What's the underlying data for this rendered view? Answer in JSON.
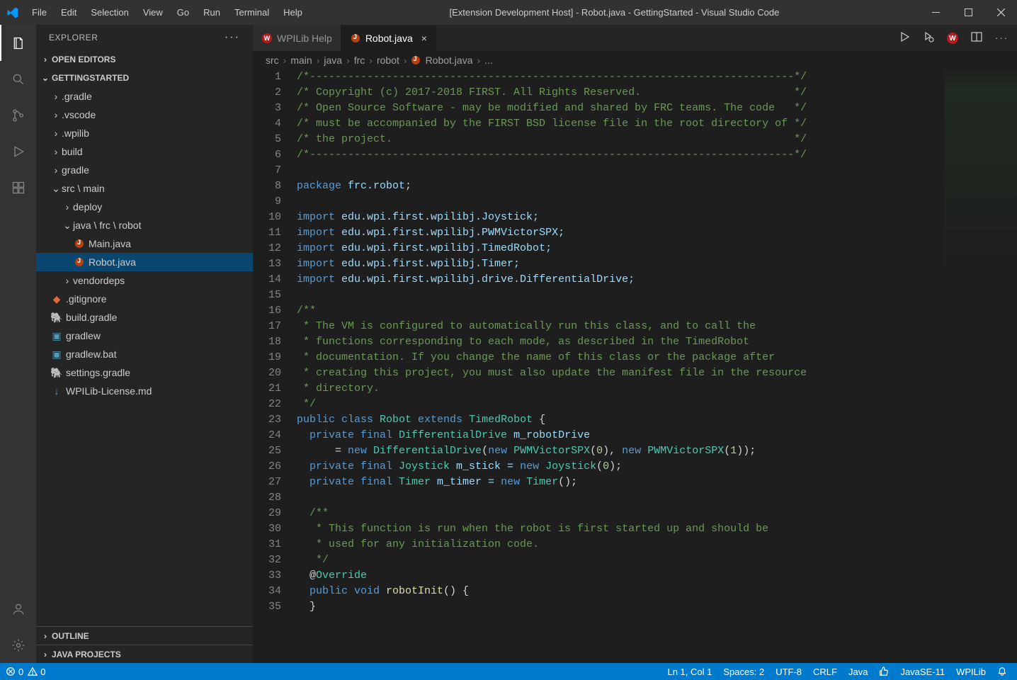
{
  "titlebar": {
    "title": "[Extension Development Host] - Robot.java - GettingStarted - Visual Studio Code"
  },
  "menubar": [
    "File",
    "Edit",
    "Selection",
    "View",
    "Go",
    "Run",
    "Terminal",
    "Help"
  ],
  "sidebar": {
    "title": "EXPLORER",
    "openEditors": "OPEN EDITORS",
    "workspace": "GETTINGSTARTED",
    "outline": "OUTLINE",
    "javaProjects": "JAVA PROJECTS",
    "tree": {
      "gradle": ".gradle",
      "vscode": ".vscode",
      "wpilib": ".wpilib",
      "build": "build",
      "gradleFolder": "gradle",
      "srcmain": "src \\ main",
      "deploy": "deploy",
      "javaFrcRobot": "java \\ frc \\ robot",
      "mainJava": "Main.java",
      "robotJava": "Robot.java",
      "vendordeps": "vendordeps",
      "gitignore": ".gitignore",
      "buildGradle": "build.gradle",
      "gradlew": "gradlew",
      "gradlewBat": "gradlew.bat",
      "settingsGradle": "settings.gradle",
      "wpilibLicense": "WPILib-License.md"
    }
  },
  "tabs": {
    "wpilibHelp": "WPILib Help",
    "robotJava": "Robot.java"
  },
  "breadcrumbs": {
    "p0": "src",
    "p1": "main",
    "p2": "java",
    "p3": "frc",
    "p4": "robot",
    "p5": "Robot.java",
    "p6": "..."
  },
  "code": {
    "l1": "/*----------------------------------------------------------------------------*/",
    "l2": "/* Copyright (c) 2017-2018 FIRST. All Rights Reserved.                        */",
    "l3": "/* Open Source Software - may be modified and shared by FRC teams. The code   */",
    "l4": "/* must be accompanied by the FIRST BSD license file in the root directory of */",
    "l5": "/* the project.                                                               */",
    "l6": "/*----------------------------------------------------------------------------*/",
    "l7": "",
    "l8a": "package",
    "l8b": " frc.robot",
    "l8c": ";",
    "l9": "",
    "l10a": "import",
    "l10b": " edu.wpi.first.wpilibj.Joystick;",
    "l11a": "import",
    "l11b": " edu.wpi.first.wpilibj.PWMVictorSPX;",
    "l12a": "import",
    "l12b": " edu.wpi.first.wpilibj.TimedRobot;",
    "l13a": "import",
    "l13b": " edu.wpi.first.wpilibj.Timer;",
    "l14a": "import",
    "l14b": " edu.wpi.first.wpilibj.drive.DifferentialDrive;",
    "l15": "",
    "l16": "/**",
    "l17": " * The VM is configured to automatically run this class, and to call the",
    "l18": " * functions corresponding to each mode, as described in the TimedRobot",
    "l19": " * documentation. If you change the name of this class or the package after",
    "l20": " * creating this project, you must also update the manifest file in the resource",
    "l21": " * directory.",
    "l22": " */",
    "l23a": "public",
    "l23b": " class",
    "l23c": " Robot",
    "l23d": " extends",
    "l23e": " TimedRobot",
    "l23f": " {",
    "l24a": "  private",
    "l24b": " final",
    "l24c": " DifferentialDrive",
    "l24d": " m_robotDrive",
    "l25a": "      = ",
    "l25b": "new",
    "l25c": " DifferentialDrive",
    "l25d": "(",
    "l25e": "new",
    "l25f": " PWMVictorSPX",
    "l25g": "(",
    "l25h": "0",
    "l25i": "), ",
    "l25j": "new",
    "l25k": " PWMVictorSPX",
    "l25l": "(",
    "l25m": "1",
    "l25n": "));",
    "l26a": "  private",
    "l26b": " final",
    "l26c": " Joystick",
    "l26d": " m_stick = ",
    "l26e": "new",
    "l26f": " Joystick",
    "l26g": "(",
    "l26h": "0",
    "l26i": ");",
    "l27a": "  private",
    "l27b": " final",
    "l27c": " Timer",
    "l27d": " m_timer = ",
    "l27e": "new",
    "l27f": " Timer",
    "l27g": "();",
    "l28": "",
    "l29": "  /**",
    "l30": "   * This function is run when the robot is first started up and should be",
    "l31": "   * used for any initialization code.",
    "l32": "   */",
    "l33a": "  @",
    "l33b": "Override",
    "l34a": "  public",
    "l34b": " void",
    "l34c": " robotInit",
    "l34d": "() {",
    "l35": "  }"
  },
  "statusbar": {
    "errors": "0",
    "warnings": "0",
    "lncol": "Ln 1, Col 1",
    "spaces": "Spaces: 2",
    "encoding": "UTF-8",
    "eol": "CRLF",
    "lang": "Java",
    "javase": "JavaSE-11",
    "wpilib": "WPILib"
  }
}
